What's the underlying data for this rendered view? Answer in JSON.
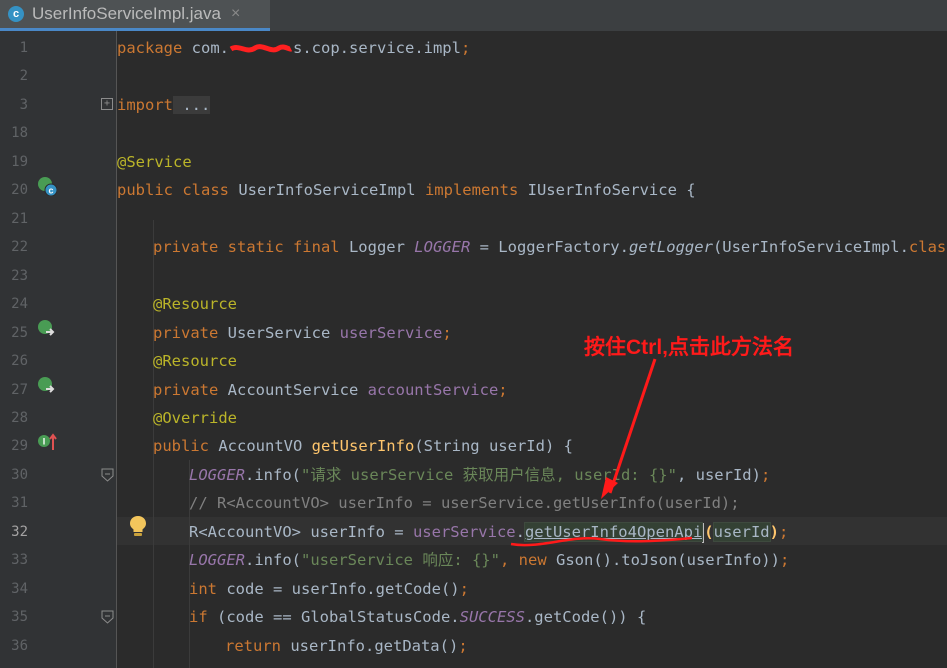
{
  "tab": {
    "icon_letter": "c",
    "title": "UserInfoServiceImpl.java",
    "close": "×"
  },
  "lines": [
    {
      "num": "1"
    },
    {
      "num": "2"
    },
    {
      "num": "3"
    },
    {
      "num": "18"
    },
    {
      "num": "19"
    },
    {
      "num": "20"
    },
    {
      "num": "21"
    },
    {
      "num": "22"
    },
    {
      "num": "23"
    },
    {
      "num": "24"
    },
    {
      "num": "25"
    },
    {
      "num": "26"
    },
    {
      "num": "27"
    },
    {
      "num": "28"
    },
    {
      "num": "29"
    },
    {
      "num": "30"
    },
    {
      "num": "31"
    },
    {
      "num": "32"
    },
    {
      "num": "33"
    },
    {
      "num": "34"
    },
    {
      "num": "35"
    },
    {
      "num": "36"
    }
  ],
  "code": {
    "l1_kw": "package",
    "l1_pkg_a": " com.",
    "l1_pkg_b": "s.cop.service.impl",
    "l1_semi": ";",
    "l3_kw": "import",
    "l3_dots": " ...",
    "l19_ann": "@Service",
    "l20_kw1": "public class",
    "l20_name": " UserInfoServiceImpl ",
    "l20_kw2": "implements",
    "l20_iface": " IUserInfoService {",
    "l22_kw": "private static final",
    "l22_type": " Logger ",
    "l22_field": "LOGGER",
    "l22_eq": " = LoggerFactory.",
    "l22_method": "getLogger",
    "l22_arg": "(UserInfoServiceImpl.",
    "l22_class": "class",
    "l22_end": ");",
    "l24_ann": "@Resource",
    "l25_kw": "private",
    "l25_type": " UserService ",
    "l25_field": "userService",
    "l25_semi": ";",
    "l26_ann": "@Resource",
    "l27_kw": "private",
    "l27_type": " AccountService ",
    "l27_field": "accountService",
    "l27_semi": ";",
    "l28_ann": "@Override",
    "l29_kw": "public",
    "l29_type": " AccountVO ",
    "l29_fn": "getUserInfo",
    "l29_params": "(String userId) {",
    "l30_field": "LOGGER",
    "l30_call": ".info(",
    "l30_str": "\"请求 userService 获取用户信息, userId: {}\"",
    "l30_end": ", userId)",
    "l30_semi": ";",
    "l31_comment": "// R<AccountVO> userInfo = userService.getUserInfo(userId);",
    "l32_type": "R<AccountVO> userInfo = ",
    "l32_field": "userService",
    "l32_dot": ".",
    "l32_method": "getUserInfo4OpenApi",
    "l32_paren_open": "(",
    "l32_arg": "userId",
    "l32_paren_close": ")",
    "l32_semi": ";",
    "l33_field": "LOGGER",
    "l33_call": ".info(",
    "l33_str": "\"userService 响应: {}\"",
    "l33_comma": ", ",
    "l33_kw": "new",
    "l33_rest": " Gson().toJson(userInfo))",
    "l33_semi": ";",
    "l34_kw": "int",
    "l34_rest": " code = userInfo.getCode()",
    "l34_semi": ";",
    "l35_kw": "if",
    "l35_a": " (code == GlobalStatusCode.",
    "l35_field": "SUCCESS",
    "l35_b": ".getCode()) {",
    "l36_kw": "return",
    "l36_rest": " userInfo.getData()",
    "l36_semi": ";"
  },
  "annotation": {
    "text": "按住Ctrl,点击此方法名"
  },
  "colors": {
    "annotation": "#ff1a1a",
    "keyword": "#cc7832",
    "annotation_code": "#bbb529",
    "field": "#9876aa",
    "method": "#ffc66d",
    "string": "#6a8759",
    "comment": "#808080",
    "text": "#a9b7c6"
  }
}
